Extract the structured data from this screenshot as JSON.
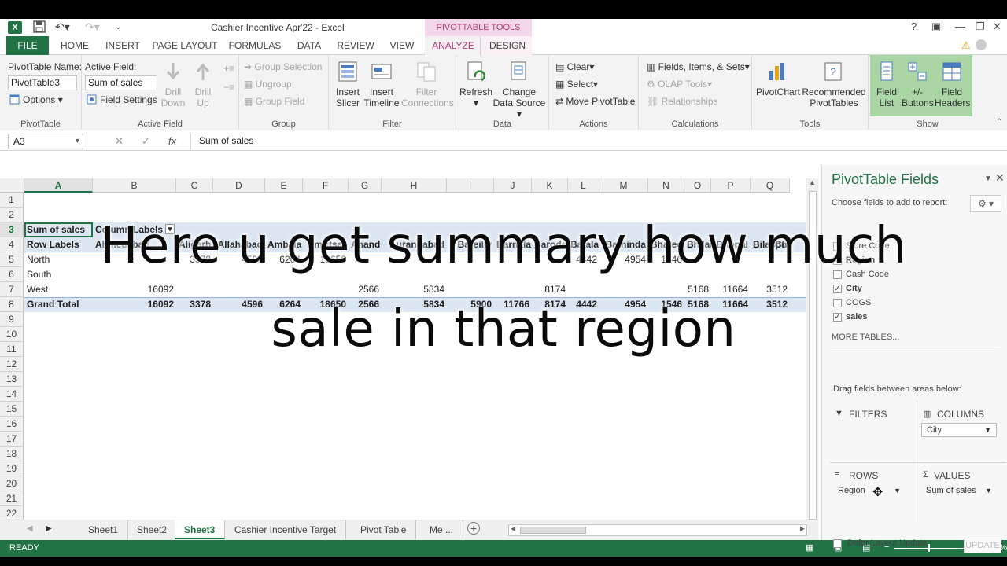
{
  "window": {
    "title": "Cashier Incentive Apr'22 - Excel",
    "context_tools": "PIVOTTABLE TOOLS",
    "help": "?"
  },
  "tabs": [
    "FILE",
    "HOME",
    "INSERT",
    "PAGE LAYOUT",
    "FORMULAS",
    "DATA",
    "REVIEW",
    "VIEW",
    "ANALYZE",
    "DESIGN"
  ],
  "ribbon": {
    "pivottable": {
      "name_label": "PivotTable Name:",
      "name_value": "PivotTable3",
      "options": "Options",
      "group": "PivotTable"
    },
    "active_field": {
      "label": "Active Field:",
      "value": "Sum of sales",
      "field_settings": "Field Settings",
      "drill_down": "Drill Down",
      "drill_up": "Drill Up",
      "group": "Active Field"
    },
    "group_grp": {
      "group_selection": "Group Selection",
      "ungroup": "Ungroup",
      "group_field": "Group Field",
      "group": "Group"
    },
    "filter": {
      "insert_slicer": "Insert Slicer",
      "insert_timeline": "Insert Timeline",
      "filter_connections": "Filter Connections",
      "group": "Filter"
    },
    "data": {
      "refresh": "Refresh",
      "change_data_source": "Change Data Source",
      "group": "Data"
    },
    "actions": {
      "clear": "Clear",
      "select": "Select",
      "move": "Move PivotTable",
      "group": "Actions"
    },
    "calculations": {
      "fields_items_sets": "Fields, Items, & Sets",
      "olap_tools": "OLAP Tools",
      "relationships": "Relationships",
      "group": "Calculations"
    },
    "tools": {
      "pivotchart": "PivotChart",
      "recommended": "Recommended PivotTables",
      "group": "Tools"
    },
    "show": {
      "field_list": "Field List",
      "buttons": "+/- Buttons",
      "field_headers": "Field Headers",
      "group": "Show"
    }
  },
  "formula_bar": {
    "name_box": "A3",
    "content": "Sum of sales"
  },
  "columns": [
    "A",
    "B",
    "C",
    "D",
    "E",
    "F",
    "G",
    "H",
    "I",
    "J",
    "K",
    "L",
    "M",
    "N",
    "O",
    "P",
    "Q"
  ],
  "rows": [
    "1",
    "2",
    "3",
    "4",
    "5",
    "6",
    "7",
    "8",
    "9",
    "10",
    "11",
    "12",
    "13",
    "14",
    "15",
    "16",
    "17",
    "18",
    "19",
    "20",
    "21",
    "22",
    "23"
  ],
  "pivot": {
    "values_label": "Sum of sales",
    "column_labels": "Column Labels",
    "row_labels": "Row Labels",
    "cities": [
      "Ahmedabad",
      "Aligarh",
      "Allahabad",
      "Ambala",
      "Amritsar",
      "Anand",
      "Aurangabad",
      "Bareilly",
      "Barnala",
      "Baroda",
      "Batala",
      "Bathinda",
      "Bhatech",
      "Bhilai",
      "Bhopal",
      "Bilaspur",
      "Ch"
    ],
    "rows": [
      {
        "label": "North",
        "values": [
          "",
          "3378",
          "4596",
          "6264",
          "18650",
          "",
          "",
          "",
          "",
          "",
          "4442",
          "4954",
          "1546",
          "",
          "",
          "",
          ""
        ]
      },
      {
        "label": "South",
        "values": [
          "",
          "",
          "",
          "",
          "",
          "",
          "",
          "",
          "",
          "",
          "",
          "",
          "",
          "",
          "",
          "",
          ""
        ]
      },
      {
        "label": "West",
        "values": [
          "16092",
          "",
          "",
          "",
          "",
          "2566",
          "5834",
          "",
          "",
          "8174",
          "",
          "",
          "",
          "5168",
          "11664",
          "3512",
          ""
        ]
      },
      {
        "label": "Grand Total",
        "values": [
          "16092",
          "3378",
          "4596",
          "6264",
          "18650",
          "2566",
          "5834",
          "5900",
          "11766",
          "8174",
          "4442",
          "4954",
          "1546",
          "5168",
          "11664",
          "3512",
          ""
        ]
      }
    ]
  },
  "sheets": [
    "Sheet1",
    "Sheet2",
    "Sheet3",
    "Cashier Incentive Target",
    "Pivot Table",
    "Me ..."
  ],
  "active_sheet": "Sheet3",
  "status": {
    "ready": "READY",
    "zoom": "100%"
  },
  "pane": {
    "title": "PivotTable Fields",
    "choose": "Choose fields to add to report:",
    "fields": [
      {
        "name": "Store Code",
        "checked": false
      },
      {
        "name": "Region",
        "checked": true
      },
      {
        "name": "Cash Code",
        "checked": false
      },
      {
        "name": "City",
        "checked": true
      },
      {
        "name": "COGS",
        "checked": false
      },
      {
        "name": "sales",
        "checked": true
      }
    ],
    "more_tables": "MORE TABLES...",
    "drag_text": "Drag fields between areas below:",
    "filters": "FILTERS",
    "columns": "COLUMNS",
    "rows": "ROWS",
    "values": "VALUES",
    "columns_field": "City",
    "rows_field": "Region",
    "values_field": "Sum of sales",
    "defer": "Defer Layout Update",
    "update": "UPDATE"
  },
  "caption": {
    "line1": "Here u get summary how much",
    "line2": "sale in that region"
  }
}
